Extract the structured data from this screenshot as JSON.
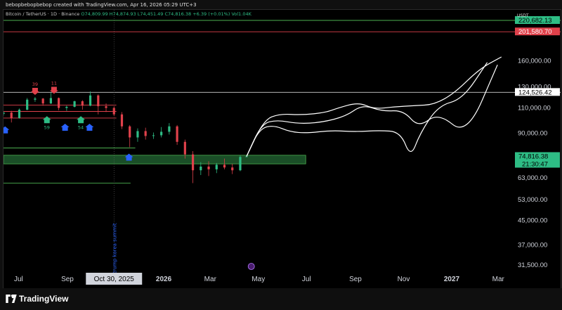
{
  "credit": "bebopbebopbebop created with TradingView.com, Apr 16, 2026 05:29 UTC+3",
  "legend": {
    "symbol": "Bitcoin / TetherUS · 1D · Binance",
    "open": "O74,809.99",
    "high": "H74,874.93",
    "low": "L74,451.49",
    "close": "C74,816.38",
    "change": "+6.39 (+0.01%)",
    "volume": "Vol1.04K"
  },
  "currency": "USDT",
  "brand": "TradingView",
  "colors": {
    "background": "#000000",
    "up": "#2ebd85",
    "down": "#e0414b",
    "zone_fill": "#1f5c2e",
    "zone_border": "#4caf50",
    "projection": "#ffffff",
    "red_line": "#e0414b",
    "green_line": "#4caf50"
  },
  "chart_data": {
    "type": "candlestick",
    "title": "",
    "xlabel": "",
    "ylabel": "",
    "y_scale": "log",
    "y_range": [
      29000,
      240000
    ],
    "x_range": [
      "2025-06-12",
      "2027-03-15"
    ],
    "x_ticks": [
      {
        "date": "2025-07-01",
        "label": "Jul"
      },
      {
        "date": "2025-09-01",
        "label": "Sep"
      },
      {
        "date": "2026-01-01",
        "label": "2026"
      },
      {
        "date": "2026-03-01",
        "label": "Mar"
      },
      {
        "date": "2026-05-01",
        "label": "May"
      },
      {
        "date": "2026-07-01",
        "label": "Jul"
      },
      {
        "date": "2026-09-01",
        "label": "Sep"
      },
      {
        "date": "2026-11-01",
        "label": "Nov"
      },
      {
        "date": "2027-01-01",
        "label": "2027"
      },
      {
        "date": "2027-03-01",
        "label": "Mar"
      }
    ],
    "x_highlight": {
      "date": "2025-10-30",
      "label": "Oct 30, 2025"
    },
    "y_ticks": [
      {
        "value": 160000,
        "label": "160,000.00"
      },
      {
        "value": 130000,
        "label": "130,000.00"
      },
      {
        "value": 110000,
        "label": "110,000.00"
      },
      {
        "value": 90000,
        "label": "90,000.00"
      },
      {
        "value": 63000,
        "label": "63,000.00"
      },
      {
        "value": 53000,
        "label": "53,000.00"
      },
      {
        "value": 45000,
        "label": "45,000.00"
      },
      {
        "value": 37000,
        "label": "37,000.00"
      },
      {
        "value": 31500,
        "label": "31,500.00"
      }
    ],
    "price_labels": [
      {
        "value": 220682.13,
        "label": "220,682.13",
        "bg": "#2ebd85",
        "fg": "#000000"
      },
      {
        "value": 201580.7,
        "label": "201,580.70",
        "bg": "#e0414b",
        "fg": "#ffffff"
      },
      {
        "value": 124526.42,
        "label": "124,526.42",
        "bg": "#ffffff",
        "fg": "#000000"
      },
      {
        "value": 74816.38,
        "label": "74,816.38",
        "bg": "#2ebd85",
        "fg": "#000000",
        "sub": "21:30:47"
      }
    ],
    "hlines": [
      {
        "value": 220682.13,
        "color": "#4caf50",
        "from": "2025-06-12",
        "to": "2027-03-15"
      },
      {
        "value": 201580.7,
        "color": "#e0414b",
        "from": "2025-06-12",
        "to": "2027-03-15"
      },
      {
        "value": 124526.42,
        "color": "#d0d0d0",
        "from": "2025-06-12",
        "to": "2027-03-15"
      },
      {
        "value": 112500,
        "color": "#e0414b",
        "from": "2025-06-12",
        "to": "2025-11-02"
      },
      {
        "value": 107000,
        "color": "#e0414b",
        "from": "2025-06-12",
        "to": "2025-11-02"
      },
      {
        "value": 101500,
        "color": "#e0414b",
        "from": "2025-06-12",
        "to": "2025-11-02"
      },
      {
        "value": 80000,
        "color": "#4caf50",
        "from": "2025-06-12",
        "to": "2025-11-26"
      },
      {
        "value": 60500,
        "color": "#4caf50",
        "from": "2025-06-12",
        "to": "2025-11-20"
      }
    ],
    "zones": [
      {
        "low": 70500,
        "high": 75500,
        "from": "2025-06-12",
        "to": "2026-06-30"
      }
    ],
    "annotations": [
      {
        "date": "2025-07-22",
        "value": 122000,
        "marker": "arrow-down",
        "color": "#e0414b",
        "label": "39"
      },
      {
        "date": "2025-08-15",
        "value": 123000,
        "marker": "arrow-down",
        "color": "#e0414b",
        "label": "11"
      },
      {
        "date": "2025-08-06",
        "value": 103000,
        "marker": "arrow-up",
        "color": "#2ebd85",
        "label": "59"
      },
      {
        "date": "2025-09-18",
        "value": 103000,
        "marker": "arrow-up",
        "color": "#2ebd85",
        "label": "54"
      },
      {
        "date": "2025-06-14",
        "value": 95000,
        "marker": "arrow-up",
        "color": "#2962ff",
        "label": ""
      },
      {
        "date": "2025-08-29",
        "value": 97000,
        "marker": "arrow-up",
        "color": "#2962ff",
        "label": ""
      },
      {
        "date": "2025-09-29",
        "value": 97000,
        "marker": "arrow-up",
        "color": "#2962ff",
        "label": ""
      },
      {
        "date": "2025-11-18",
        "value": 76500,
        "marker": "arrow-up",
        "color": "#2962ff",
        "label": ""
      }
    ],
    "vertical_event": {
      "date": "2025-10-30",
      "label": "trump korea summit"
    },
    "ohlc": [
      [
        "2025-06-12",
        105000,
        107000,
        103500,
        106000
      ],
      [
        "2025-06-22",
        106000,
        107500,
        98000,
        101500
      ],
      [
        "2025-07-02",
        101500,
        109500,
        101000,
        108500
      ],
      [
        "2025-07-12",
        108500,
        119000,
        108000,
        117500
      ],
      [
        "2025-07-22",
        117500,
        120000,
        115500,
        118500
      ],
      [
        "2025-08-01",
        118500,
        119000,
        112000,
        114000
      ],
      [
        "2025-08-11",
        114000,
        124000,
        113500,
        119000
      ],
      [
        "2025-08-21",
        119000,
        119500,
        108000,
        110000
      ],
      [
        "2025-08-31",
        110000,
        112000,
        107500,
        111000
      ],
      [
        "2025-09-10",
        111000,
        116500,
        110500,
        116000
      ],
      [
        "2025-09-20",
        116000,
        117000,
        108500,
        112000
      ],
      [
        "2025-09-30",
        112000,
        125500,
        111500,
        121500
      ],
      [
        "2025-10-10",
        121500,
        122500,
        104500,
        111500
      ],
      [
        "2025-10-20",
        111500,
        114000,
        106500,
        110000
      ],
      [
        "2025-10-30",
        110000,
        111500,
        103000,
        104500
      ],
      [
        "2025-11-09",
        104500,
        106500,
        93000,
        95000
      ],
      [
        "2025-11-19",
        95000,
        96000,
        80500,
        87000
      ],
      [
        "2025-11-29",
        87000,
        93500,
        84000,
        91500
      ],
      [
        "2025-12-09",
        91500,
        94000,
        85500,
        88000
      ],
      [
        "2025-12-19",
        88000,
        90500,
        86000,
        88500
      ],
      [
        "2025-12-29",
        88500,
        94500,
        87000,
        91000
      ],
      [
        "2026-01-08",
        91000,
        97500,
        89000,
        95000
      ],
      [
        "2026-01-18",
        95000,
        96000,
        82000,
        84000
      ],
      [
        "2026-01-28",
        84000,
        85500,
        73500,
        76000
      ],
      [
        "2026-02-07",
        76000,
        78000,
        60500,
        67000
      ],
      [
        "2026-02-17",
        67000,
        71500,
        64500,
        69000
      ],
      [
        "2026-02-27",
        69000,
        72000,
        64000,
        67500
      ],
      [
        "2026-03-09",
        67500,
        71000,
        65500,
        70000
      ],
      [
        "2026-03-19",
        70000,
        73500,
        67500,
        68500
      ],
      [
        "2026-03-29",
        68500,
        70500,
        65000,
        67000
      ],
      [
        "2026-04-08",
        67000,
        75500,
        66500,
        74500
      ],
      [
        "2026-04-16",
        74810,
        74875,
        74451,
        74816
      ]
    ],
    "projection_paths": [
      [
        [
          "2026-04-16",
          74816
        ],
        [
          "2026-05-02",
          93000
        ],
        [
          "2026-05-20",
          96000
        ],
        [
          "2026-06-10",
          91000
        ],
        [
          "2026-07-01",
          90000
        ],
        [
          "2026-08-01",
          92000
        ],
        [
          "2026-09-01",
          91000
        ],
        [
          "2026-10-01",
          92000
        ],
        [
          "2026-10-28",
          91000
        ],
        [
          "2026-11-10",
          74000
        ],
        [
          "2026-11-22",
          90000
        ],
        [
          "2026-12-15",
          112000
        ],
        [
          "2027-01-15",
          118000
        ],
        [
          "2027-02-15",
          158000
        ]
      ],
      [
        [
          "2026-04-16",
          74816
        ],
        [
          "2026-05-05",
          97000
        ],
        [
          "2026-05-25",
          100000
        ],
        [
          "2026-06-20",
          97000
        ],
        [
          "2026-07-20",
          98000
        ],
        [
          "2026-08-20",
          103000
        ],
        [
          "2026-09-10",
          113000
        ],
        [
          "2026-10-05",
          107000
        ],
        [
          "2026-11-01",
          108000
        ],
        [
          "2026-11-20",
          94000
        ],
        [
          "2026-12-15",
          106000
        ],
        [
          "2027-01-20",
          88000
        ],
        [
          "2027-02-28",
          155000
        ]
      ],
      [
        [
          "2026-04-16",
          74816
        ],
        [
          "2026-05-08",
          100000
        ],
        [
          "2026-05-28",
          105000
        ],
        [
          "2026-06-25",
          104000
        ],
        [
          "2026-07-25",
          106000
        ],
        [
          "2026-08-10",
          110000
        ],
        [
          "2026-09-05",
          115000
        ],
        [
          "2026-09-25",
          109000
        ],
        [
          "2026-10-20",
          111000
        ],
        [
          "2026-11-15",
          112000
        ],
        [
          "2026-12-10",
          113000
        ],
        [
          "2027-01-05",
          124000
        ],
        [
          "2027-02-05",
          150000
        ],
        [
          "2027-03-05",
          165000
        ]
      ]
    ]
  }
}
